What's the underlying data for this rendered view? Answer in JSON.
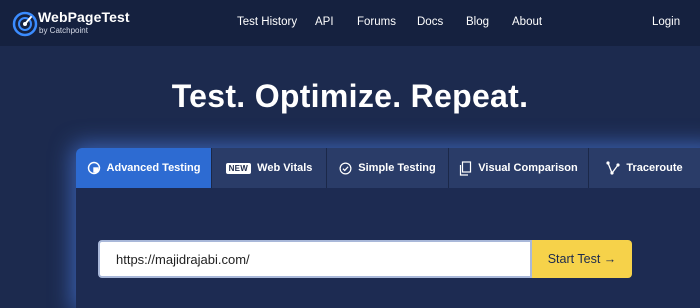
{
  "brand": {
    "name": "WebPageTest",
    "subtitle": "by Catchpoint"
  },
  "nav": {
    "items": [
      "Test History",
      "API",
      "Forums",
      "Docs",
      "Blog",
      "About"
    ],
    "login": "Login"
  },
  "hero": {
    "title": "Test. Optimize. Repeat."
  },
  "tabs": [
    {
      "label": "Advanced Testing",
      "icon": "advanced-testing-icon",
      "active": true
    },
    {
      "label": "Web Vitals",
      "badge": "NEW",
      "icon": "new-badge"
    },
    {
      "label": "Simple Testing",
      "icon": "check-circle-icon"
    },
    {
      "label": "Visual Comparison",
      "icon": "documents-icon"
    },
    {
      "label": "Traceroute",
      "icon": "traceroute-icon"
    }
  ],
  "form": {
    "url_value": "https://majidrajabi.com/",
    "start_label": "Start Test →"
  },
  "colors": {
    "background": "#1c2a4e",
    "topbar": "#15213f",
    "active_tab": "#2d6bd2",
    "tab": "#2a3c68",
    "button": "#f6d24a",
    "logo_accent": "#3b8cff"
  }
}
